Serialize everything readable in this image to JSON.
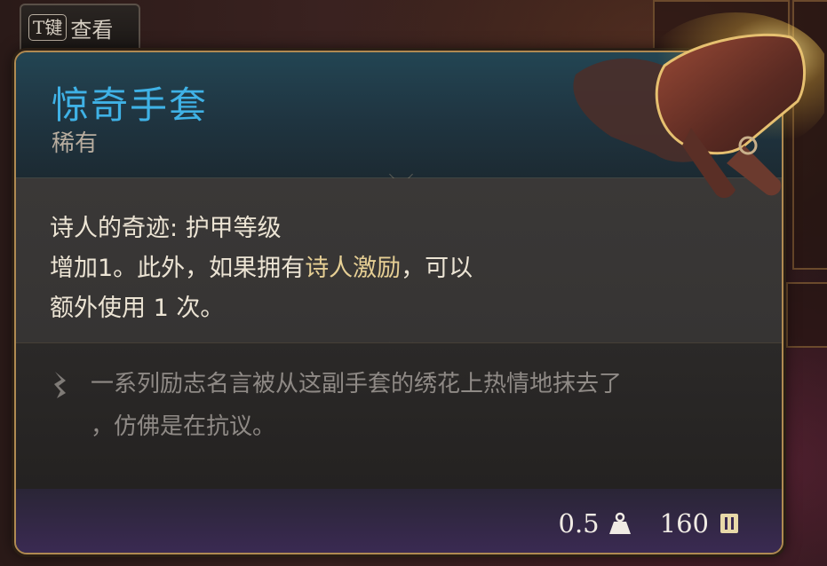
{
  "hotkey": {
    "key": "T键",
    "label": "查看"
  },
  "item": {
    "name": "惊奇手套",
    "rarity": "稀有",
    "effect_line1_prefix": "诗人的奇迹",
    "effect_line1_sep": ": ",
    "effect_line1_rest": "护甲等级",
    "effect_line2_a": "增加1。此外，如果拥有",
    "effect_line2_highlight": "诗人激励",
    "effect_line2_b": "，可以",
    "effect_line3": "额外使用 1 次。",
    "flavor_line1": "一系列励志名言被从这副手套的绣花上热情地抹去了",
    "flavor_line2": "，仿佛是在抗议。",
    "weight": "0.5",
    "value": "160"
  },
  "icons": {
    "weight": "weight-icon",
    "value": "gold-coin-icon",
    "flavor": "quill-icon",
    "item": "gloves-icon"
  },
  "colors": {
    "title": "#3fb2e6",
    "highlight": "#e6cf94",
    "border": "#b08a52"
  }
}
